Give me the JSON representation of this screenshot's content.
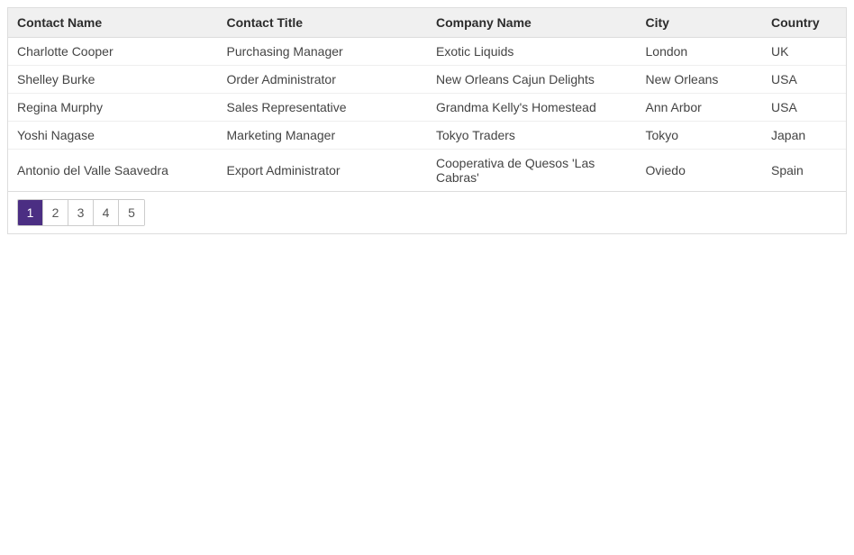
{
  "table": {
    "headers": {
      "contact_name": "Contact Name",
      "contact_title": "Contact Title",
      "company_name": "Company Name",
      "city": "City",
      "country": "Country"
    },
    "rows": [
      {
        "contact_name": "Charlotte Cooper",
        "contact_title": "Purchasing Manager",
        "company_name": "Exotic Liquids",
        "city": "London",
        "country": "UK"
      },
      {
        "contact_name": "Shelley Burke",
        "contact_title": "Order Administrator",
        "company_name": "New Orleans Cajun Delights",
        "city": "New Orleans",
        "country": "USA"
      },
      {
        "contact_name": "Regina Murphy",
        "contact_title": "Sales Representative",
        "company_name": "Grandma Kelly's Homestead",
        "city": "Ann Arbor",
        "country": "USA"
      },
      {
        "contact_name": "Yoshi Nagase",
        "contact_title": "Marketing Manager",
        "company_name": "Tokyo Traders",
        "city": "Tokyo",
        "country": "Japan"
      },
      {
        "contact_name": "Antonio del Valle Saavedra",
        "contact_title": "Export Administrator",
        "company_name": "Cooperativa de Quesos 'Las Cabras'",
        "city": "Oviedo",
        "country": "Spain"
      }
    ]
  },
  "pager": {
    "pages": [
      "1",
      "2",
      "3",
      "4",
      "5"
    ],
    "active": "1"
  }
}
